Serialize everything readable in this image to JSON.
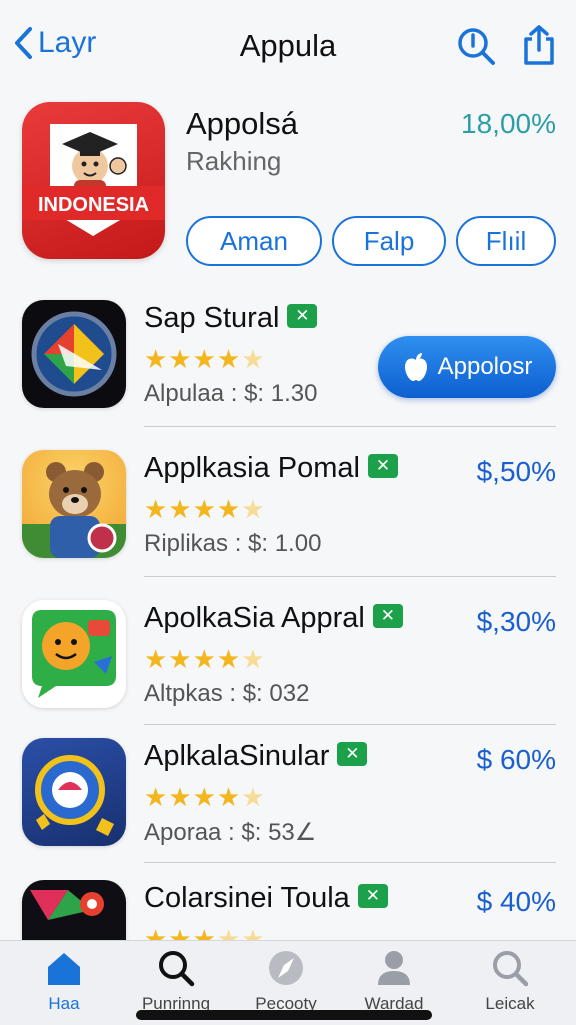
{
  "nav": {
    "back_label": "Layr",
    "title": "Appula"
  },
  "hero": {
    "name": "Appolsá",
    "subtitle": "Rakhing",
    "percent": "18,00%",
    "icon_text": "INDONESIA",
    "pills": [
      "Aman",
      "Falp",
      "Flıil"
    ]
  },
  "apps": [
    {
      "name": "Sap Stural",
      "rating": 4,
      "price": "Alpulaa : $: 1.30",
      "action": "Appolosr",
      "icon": "map-icon"
    },
    {
      "name": "Applkasia Pomal",
      "rating": 4,
      "price": "Riplikas : $: 1.00",
      "percent": "$,50%",
      "icon": "bear-icon"
    },
    {
      "name": "ApolkaSia Appral",
      "rating": 4,
      "price": "Altpkas : $: 032",
      "percent": "$,30%",
      "icon": "chat-face-icon"
    },
    {
      "name": "AplkalaSinular",
      "rating": 4,
      "price": "Aporaa : $: 53∠",
      "percent": "$ 60%",
      "icon": "game-wheel-icon"
    },
    {
      "name": "Colarsinei Toula",
      "rating": 3,
      "price": "",
      "percent": "$ 40%",
      "icon": "pin-icon"
    }
  ],
  "tabs": [
    {
      "label": "Haa",
      "icon": "home-icon",
      "active": true
    },
    {
      "label": "Punrinng",
      "icon": "search-icon",
      "active": false
    },
    {
      "label": "Pecooty",
      "icon": "compass-icon",
      "active": false
    },
    {
      "label": "Wardad",
      "icon": "person-icon",
      "active": false
    },
    {
      "label": "Leicak",
      "icon": "search-icon",
      "active": false
    }
  ],
  "colors": {
    "accent": "#1a73d9",
    "star": "#f3b61f",
    "badge": "#1da04a",
    "hero_icon": "#d92525"
  }
}
